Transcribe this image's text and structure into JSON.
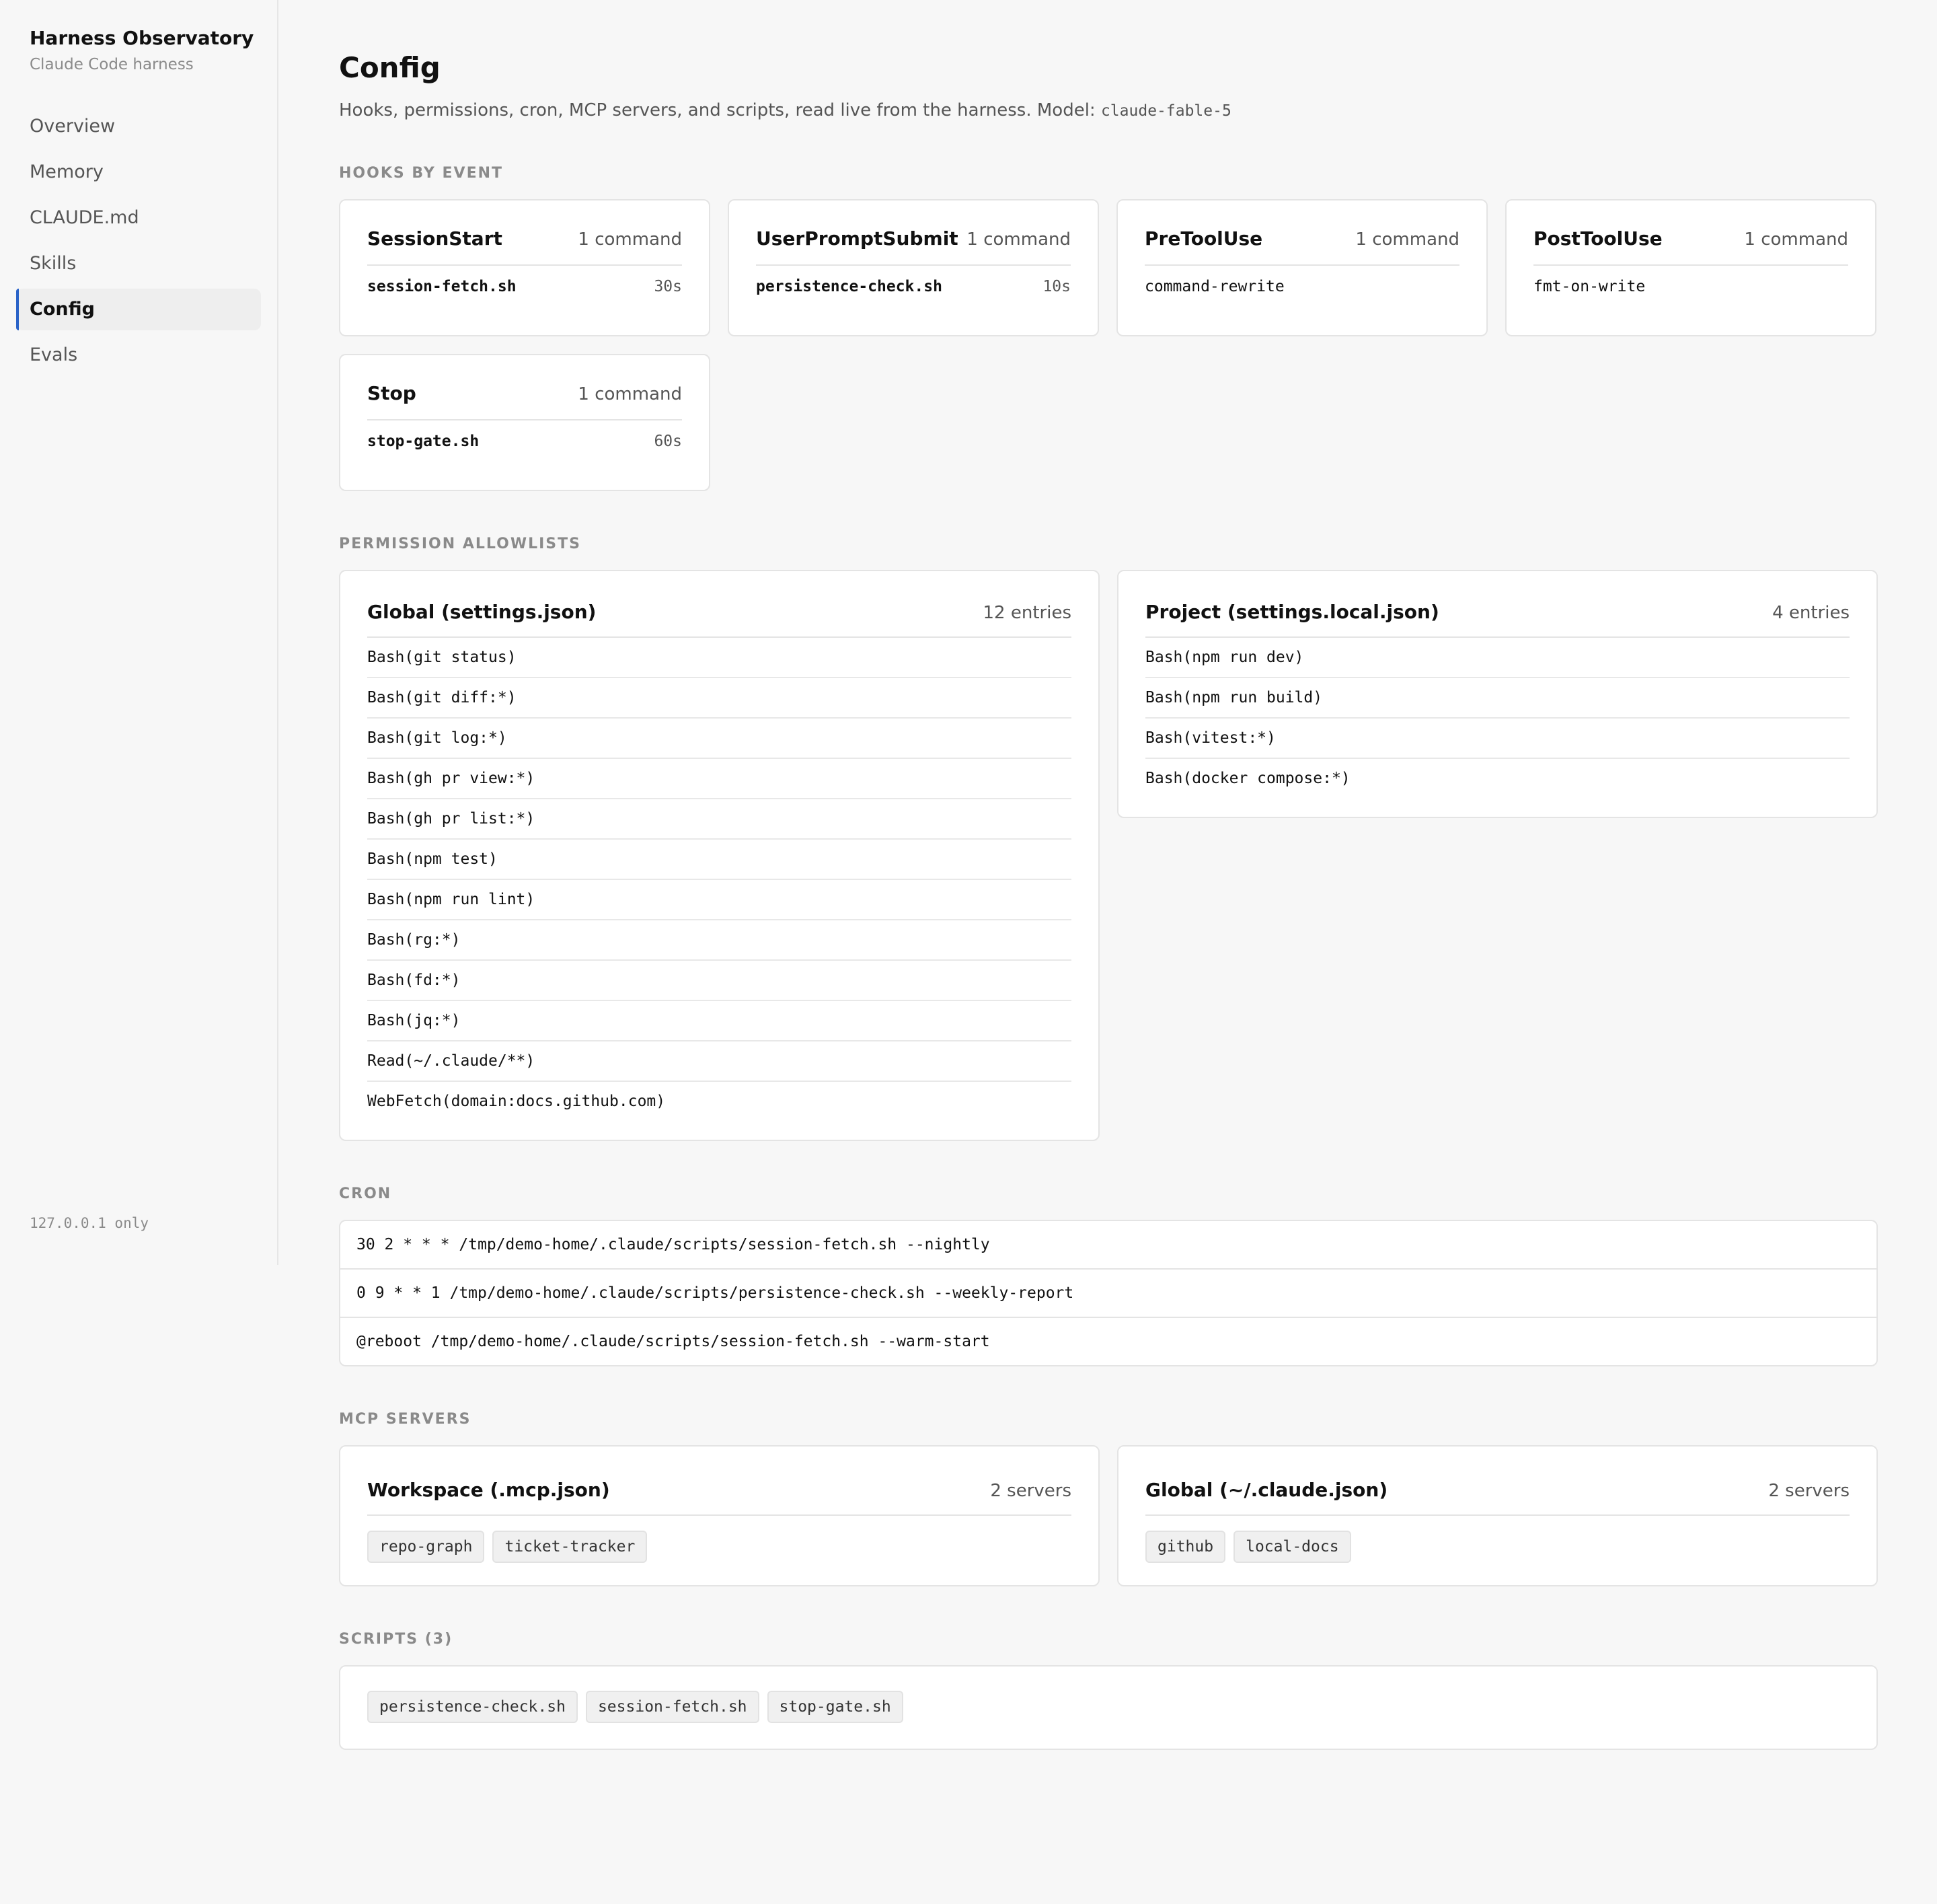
{
  "sidebar": {
    "title": "Harness Observatory",
    "subtitle": "Claude Code harness",
    "items": [
      {
        "label": "Overview",
        "active": false
      },
      {
        "label": "Memory",
        "active": false
      },
      {
        "label": "CLAUDE.md",
        "active": false
      },
      {
        "label": "Skills",
        "active": false
      },
      {
        "label": "Config",
        "active": true
      },
      {
        "label": "Evals",
        "active": false
      }
    ],
    "footer": "127.0.0.1 only"
  },
  "page": {
    "title": "Config",
    "description": "Hooks, permissions, cron, MCP servers, and scripts, read live from the harness. Model:",
    "model": "claude-fable-5"
  },
  "accent_color": "#2a63c8",
  "hooks": {
    "section_title": "HOOKS BY EVENT",
    "events": [
      {
        "name": "SessionStart",
        "count": "1 command",
        "command": "session-fetch.sh",
        "timeout": "30s"
      },
      {
        "name": "UserPromptSubmit",
        "count": "1 command",
        "command": "persistence-check.sh",
        "timeout": "10s"
      },
      {
        "name": "PreToolUse",
        "count": "1 command",
        "command": "command-rewrite",
        "timeout": ""
      },
      {
        "name": "PostToolUse",
        "count": "1 command",
        "command": "fmt-on-write",
        "timeout": ""
      },
      {
        "name": "Stop",
        "count": "1 command",
        "command": "stop-gate.sh",
        "timeout": "60s"
      }
    ]
  },
  "permissions": {
    "section_title": "PERMISSION ALLOWLISTS",
    "global": {
      "title": "Global (settings.json)",
      "count": "12 entries",
      "entries": [
        "Bash(git status)",
        "Bash(git diff:*)",
        "Bash(git log:*)",
        "Bash(gh pr view:*)",
        "Bash(gh pr list:*)",
        "Bash(npm test)",
        "Bash(npm run lint)",
        "Bash(rg:*)",
        "Bash(fd:*)",
        "Bash(jq:*)",
        "Read(~/.claude/**)",
        "WebFetch(domain:docs.github.com)"
      ]
    },
    "project": {
      "title": "Project (settings.local.json)",
      "count": "4 entries",
      "entries": [
        "Bash(npm run dev)",
        "Bash(npm run build)",
        "Bash(vitest:*)",
        "Bash(docker compose:*)"
      ]
    }
  },
  "cron": {
    "section_title": "CRON",
    "jobs": [
      "30 2 * * * /tmp/demo-home/.claude/scripts/session-fetch.sh --nightly",
      "0 9 * * 1 /tmp/demo-home/.claude/scripts/persistence-check.sh --weekly-report",
      "@reboot /tmp/demo-home/.claude/scripts/session-fetch.sh --warm-start"
    ]
  },
  "mcp": {
    "section_title": "MCP SERVERS",
    "workspace": {
      "title": "Workspace (.mcp.json)",
      "count": "2 servers",
      "servers": [
        "repo-graph",
        "ticket-tracker"
      ]
    },
    "global": {
      "title": "Global (~/.claude.json)",
      "count": "2 servers",
      "servers": [
        "github",
        "local-docs"
      ]
    }
  },
  "scripts": {
    "section_title": "SCRIPTS (3)",
    "items": [
      "persistence-check.sh",
      "session-fetch.sh",
      "stop-gate.sh"
    ]
  }
}
